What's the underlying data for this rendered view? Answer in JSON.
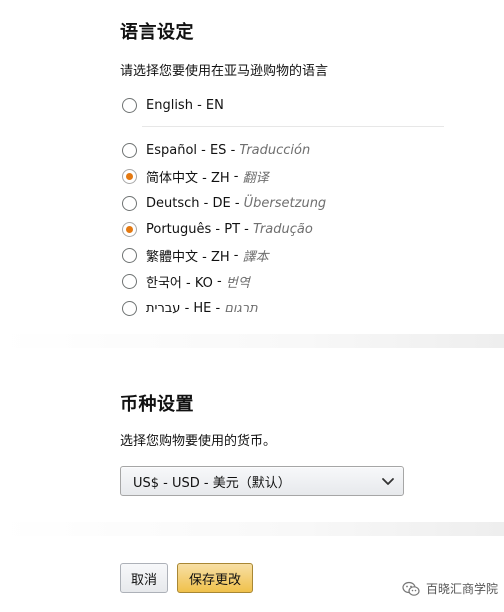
{
  "language_section": {
    "title": "语言设定",
    "subtitle": "请选择您要使用在亚马逊购物的语言",
    "options": [
      {
        "name": "English - EN",
        "translation": "",
        "selected": false
      },
      {
        "name": "Español - ES",
        "translation": "Traducción",
        "selected": false
      },
      {
        "name": "简体中文 - ZH",
        "translation": "翻译",
        "selected": true
      },
      {
        "name": "Deutsch - DE",
        "translation": "Übersetzung",
        "selected": false
      },
      {
        "name": "Português - PT",
        "translation": "Tradução",
        "selected": false
      },
      {
        "name": "繁體中文 - ZH",
        "translation": "譯本",
        "selected": false
      },
      {
        "name": "한국어 - KO",
        "translation": "번역",
        "selected": false
      },
      {
        "name": "עברית - HE",
        "translation": "תרגום",
        "selected": false
      }
    ]
  },
  "currency_section": {
    "title": "币种设置",
    "subtitle": "选择您购物要使用的货币。",
    "selected_value": "US$ - USD - 美元（默认）"
  },
  "buttons": {
    "cancel": "取消",
    "save": "保存更改"
  },
  "watermark": {
    "text": "百晓汇商学院"
  },
  "colors": {
    "radio_accent": "#e47911",
    "save_button": "#f0c14b",
    "translation_text": "#6f6f6f"
  }
}
